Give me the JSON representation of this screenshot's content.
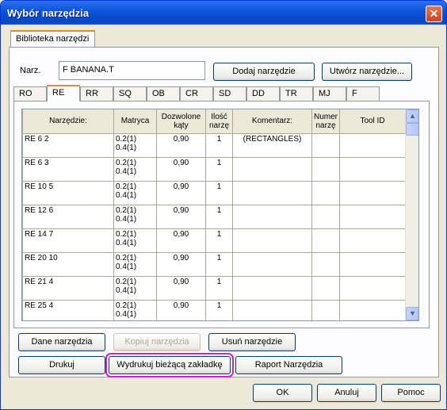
{
  "window": {
    "title": "Wybór narzędzia",
    "close": "✕"
  },
  "outer_tab": "Biblioteka narzędzi",
  "narz": {
    "label": "Narz.",
    "value": "F BANANA.T"
  },
  "top_buttons": {
    "add": "Dodaj narzędzie",
    "create": "Utwórz narzędzie..."
  },
  "inner_tabs": [
    "RO",
    "RE",
    "RR",
    "SQ",
    "OB",
    "CR",
    "SD",
    "DD",
    "TR",
    "MJ",
    "F"
  ],
  "active_tab": "RE",
  "grid": {
    "columns": [
      "Narzędzie:",
      "Matryca",
      "Dozwolone kąty",
      "Ilość narzę",
      "Komentarz:",
      "Numer narzę",
      "Tool ID"
    ],
    "rows": [
      {
        "tool": "RE 6 2",
        "matrix1": "0.2(1)",
        "matrix2": "0.4(1)",
        "angle": "0,90",
        "qty": "1",
        "comment": "(RECTANGLES)",
        "num": "",
        "id": ""
      },
      {
        "tool": "RE 6 3",
        "matrix1": "0.2(1)",
        "matrix2": "0.4(1)",
        "angle": "0,90",
        "qty": "1",
        "comment": "",
        "num": "",
        "id": ""
      },
      {
        "tool": "RE 10 5",
        "matrix1": "0.2(1)",
        "matrix2": "0.4(1)",
        "angle": "0,90",
        "qty": "1",
        "comment": "",
        "num": "",
        "id": ""
      },
      {
        "tool": "RE 12 6",
        "matrix1": "0.2(1)",
        "matrix2": "0.4(1)",
        "angle": "0,90",
        "qty": "1",
        "comment": "",
        "num": "",
        "id": ""
      },
      {
        "tool": "RE 14 7",
        "matrix1": "0.2(1)",
        "matrix2": "0.4(1)",
        "angle": "0,90",
        "qty": "1",
        "comment": "",
        "num": "",
        "id": ""
      },
      {
        "tool": "RE 20 10",
        "matrix1": "0.2(1)",
        "matrix2": "0.4(1)",
        "angle": "0,90",
        "qty": "1",
        "comment": "",
        "num": "",
        "id": ""
      },
      {
        "tool": "RE 21 4",
        "matrix1": "0.2(1)",
        "matrix2": "0.4(1)",
        "angle": "0,90",
        "qty": "1",
        "comment": "",
        "num": "",
        "id": ""
      },
      {
        "tool": "RE 25 4",
        "matrix1": "0.2(1)",
        "matrix2": "0.4(1)",
        "angle": "0,90",
        "qty": "1",
        "comment": "",
        "num": "",
        "id": ""
      }
    ]
  },
  "scrollbar": {
    "up": "▲",
    "down": "▼"
  },
  "row1_buttons": {
    "details": "Dane narzędzia",
    "copy": "Kopiuj narzędzia",
    "delete": "Usuń narzędzie"
  },
  "row2_buttons": {
    "print": "Drukuj",
    "print_tab": "Wydrukuj bieżącą zakładkę",
    "report": "Raport Narzędzia"
  },
  "dialog_buttons": {
    "ok": "OK",
    "cancel": "Anuluj",
    "help": "Pomoc"
  },
  "colors": {
    "titlebar": "#0a53d9",
    "highlight": "#d21cd2",
    "tab_accent": "#e68b2c"
  }
}
